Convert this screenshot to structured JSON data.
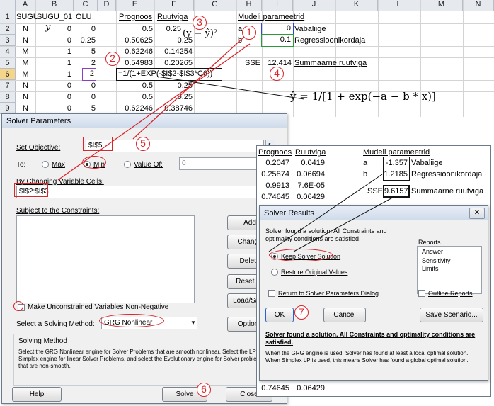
{
  "sheet": {
    "columns": [
      "A",
      "B",
      "C",
      "D",
      "E",
      "F",
      "G",
      "H",
      "I",
      "J",
      "K",
      "L",
      "M",
      "N"
    ],
    "rows": [
      "1",
      "2",
      "3",
      "4",
      "5",
      "6",
      "7",
      "8",
      "9"
    ],
    "h_sugu": "SUGU",
    "h_sugu01": "SUGU_01",
    "h_olu": "OLU",
    "h_prog": "Prognoos",
    "h_ruut": "Ruutviga",
    "y_label": "y",
    "a": [
      "N",
      "N",
      "M",
      "M",
      "M",
      "N",
      "N",
      "N"
    ],
    "b": [
      "0",
      "0",
      "1",
      "1",
      "1",
      "0",
      "0",
      "0"
    ],
    "c": [
      "0",
      "0.25",
      "5",
      "2",
      "2",
      "0",
      "0",
      "5"
    ],
    "e": [
      "0.5",
      "0.50625",
      "0.62246",
      "0.54983",
      "",
      "0.5",
      "0.5",
      "0.62246"
    ],
    "f": [
      "0.25",
      "0.25",
      "0.14254",
      "0.20265",
      "",
      "0.25",
      "0.25",
      "0.38746"
    ],
    "f2_partial": "0.25",
    "e6_formula": "=1/(1+EXP(-$I$2-$I$3*C6))",
    "sq_label": "(y − ŷ)²",
    "mudeli": "Mudeli parameetrid",
    "a_lbl": "a",
    "b_lbl": "b",
    "a_val": "0",
    "b_val": "0.1",
    "vaba": "Vabaliige",
    "regr": "Regressioonikordaja",
    "sse": "SSE",
    "sse_val": "12.414",
    "summaarne": "Summaarne ruutviga",
    "model_formula": "ŷ = 1/[1 + exp(−a − b * x)]"
  },
  "callouts": {
    "n1": "1",
    "n2": "2",
    "n3": "3",
    "n4": "4",
    "n5": "5",
    "n6": "6",
    "n7": "7"
  },
  "solver": {
    "title": "Solver Parameters",
    "set_objective": "Set Objective:",
    "objective": "$I$5",
    "to": "To:",
    "max": "Max",
    "min": "Min",
    "value_of": "Value Of:",
    "value": "0",
    "by_changing": "By Changing Variable Cells:",
    "changing": "$I$2:$I$3",
    "subject": "Subject to the Constraints:",
    "add": "Add",
    "change": "Change",
    "delete": "Delete",
    "reset": "Reset All",
    "load": "Load/Save",
    "nonneg": "Make Unconstrained Variables Non-Negative",
    "method_lbl": "Select a Solving Method:",
    "method": "GRG Nonlinear",
    "options": "Options",
    "solving_method": "Solving Method",
    "desc": "Select the GRG Nonlinear engine for Solver Problems that are smooth nonlinear. Select the LP Simplex engine for linear Solver Problems, and select the Evolutionary engine for Solver problems that are non-smooth.",
    "help": "Help",
    "solve": "Solve",
    "close": "Close"
  },
  "result_sheet": {
    "h_prog": "Prognoos",
    "h_ruut": "Ruutviga",
    "mudeli": "Mudeli parameetrid",
    "rows": [
      [
        "0.2047",
        "0.0419"
      ],
      [
        "0.25874",
        "0.06694"
      ],
      [
        "0.9913",
        "7.6E-05"
      ],
      [
        "0.74645",
        "0.06429"
      ],
      [
        "0.74645",
        "0.06429"
      ]
    ],
    "a": "a",
    "b": "b",
    "a_val": "-1.357",
    "b_val": "1.2185",
    "vaba": "Vabaliige",
    "regr": "Regressioonikordaja",
    "sse": "SSE",
    "sse_val": "9.6157",
    "summaarne": "Summaarne ruutviga",
    "bottom_val": "0.74645",
    "bottom_val2": "0.06429"
  },
  "results": {
    "title": "Solver Results",
    "found": "Solver found a solution.  All Constraints and optimality conditions are satisfied.",
    "reports": "Reports",
    "report_items": [
      "Answer",
      "Sensitivity",
      "Limits"
    ],
    "keep": "Keep Solver Solution",
    "restore": "Restore Original Values",
    "return": "Return to Solver Parameters Dialog",
    "outline": "Outline Reports",
    "ok": "OK",
    "cancel": "Cancel",
    "save": "Save Scenario...",
    "msg_bold": "Solver found a solution.  All Constraints and optimality conditions are satisfied.",
    "msg": "When the GRG engine is used, Solver has found at least a local optimal solution. When Simplex LP is used, this means Solver has found a global optimal solution."
  },
  "colors": {
    "accent": "#d8262b",
    "grid": "#d4d4d4",
    "header": "#e6e9ee"
  }
}
